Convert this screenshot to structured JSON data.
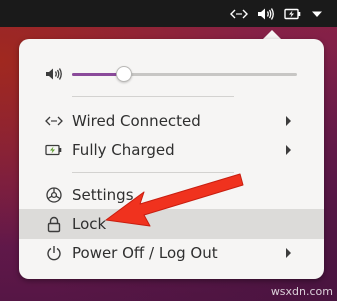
{
  "top_bar": {
    "network_icon": "network-wired-icon",
    "volume_icon": "volume-icon",
    "battery_icon": "battery-charging-icon",
    "dropdown_icon": "menu-dropdown-icon"
  },
  "menu": {
    "volume": {
      "icon": "volume-icon",
      "level": 0.23
    },
    "items": [
      {
        "icon": "network-wired-icon",
        "label": "Wired Connected",
        "has_submenu": true
      },
      {
        "icon": "battery-charging-icon",
        "label": "Fully Charged",
        "has_submenu": true
      },
      {
        "icon": "settings-icon",
        "label": "Settings",
        "has_submenu": false
      },
      {
        "icon": "lock-icon",
        "label": "Lock",
        "has_submenu": false,
        "highlighted": true
      },
      {
        "icon": "power-icon",
        "label": "Power Off / Log Out",
        "has_submenu": true
      }
    ]
  },
  "annotation": {
    "arrow_color": "#f0321e"
  },
  "colors": {
    "accent": "#8a4a9a",
    "menu_bg": "#f6f5f4",
    "highlight": "#dcdbd9"
  },
  "watermark": "wsxdn.com"
}
